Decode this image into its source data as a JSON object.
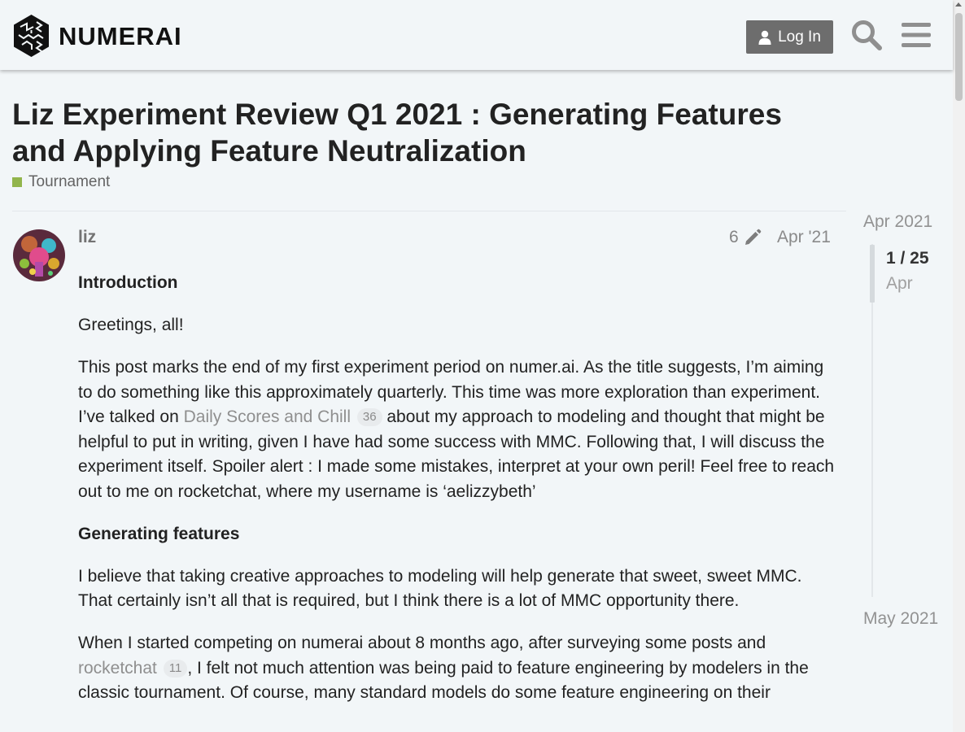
{
  "header": {
    "brand": "NUMERAI",
    "login_label": "Log In"
  },
  "topic": {
    "title": "Liz Experiment Review Q1 2021 : Generating Features and Applying Feature Neutralization",
    "category": "Tournament",
    "category_color": "#92b54c"
  },
  "post": {
    "username": "liz",
    "edit_count": "6",
    "date": "Apr '21",
    "heading_intro": "Introduction",
    "greeting": "Greetings, all!",
    "p1_a": "This post marks the end of my first experiment period on numer.ai. As the title suggests, I’m aiming to do something like this approximately quarterly. This time was more exploration than experiment. I’ve talked on ",
    "p1_link": "Daily Scores and Chill",
    "p1_link_count": "36",
    "p1_b": " about my approach to modeling and thought that might be helpful to put in writing, given I have had some success with MMC. Following that, I will discuss the experiment itself. Spoiler alert : I made some mistakes, interpret at your own peril! Feel free to reach out to me on rocketchat, where my username is ‘aelizzybeth’",
    "heading_features": "Generating features",
    "p2": "I believe that taking creative approaches to modeling will help generate that sweet, sweet MMC. That certainly isn’t all that is required, but I think there is a lot of MMC opportunity there.",
    "p3_a": "When I started competing on numerai about 8 months ago, after surveying some posts and ",
    "p3_link": "rocketchat",
    "p3_link_count": "11",
    "p3_b": ", I felt not much attention was being paid to feature engineering by modelers in the classic tournament. Of course, many standard models do some feature engineering on their"
  },
  "timeline": {
    "start": "Apr 2021",
    "position": "1 / 25",
    "month": "Apr",
    "end": "May 2021"
  }
}
